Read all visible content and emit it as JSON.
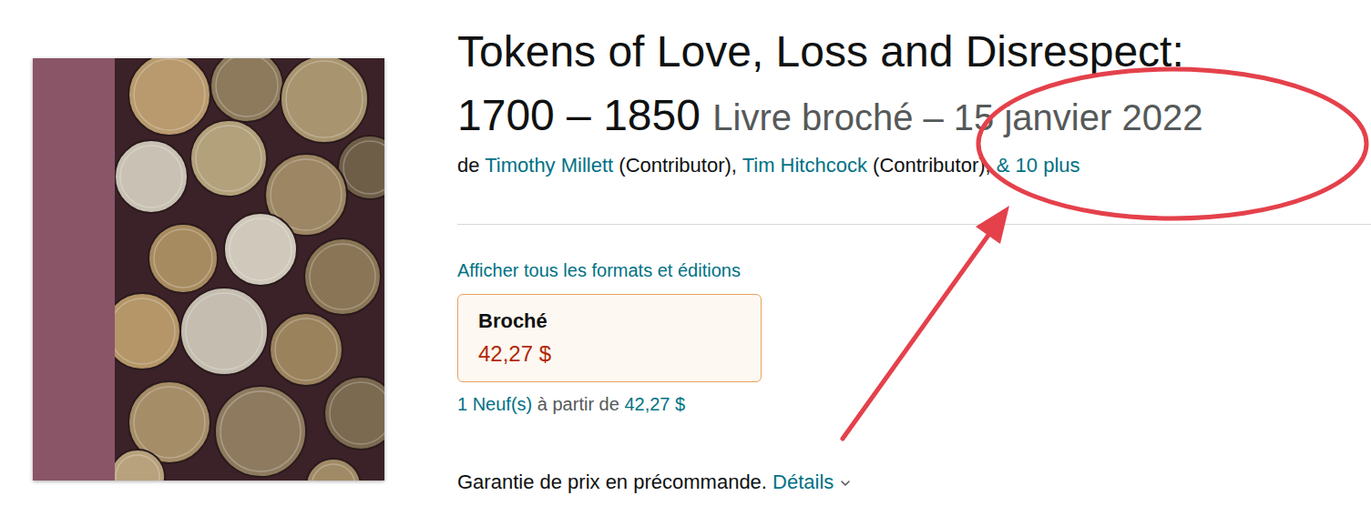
{
  "product": {
    "title_lines": [
      "Tokens of Love, Loss and Disrespect:",
      "1700 – 1850"
    ],
    "binding": "Livre broché – 15 janvier 2022",
    "byline": {
      "prefix": "de",
      "contributors": [
        {
          "name": "Timothy Millett",
          "role": "(Contributor),"
        },
        {
          "name": "Tim Hitchcock",
          "role": "(Contributor),"
        }
      ],
      "more": "& 10 plus"
    },
    "formats_link": "Afficher tous les formats et éditions",
    "formats": [
      {
        "label": "Broché",
        "price": "42,27 $",
        "selected": true
      }
    ],
    "offers": {
      "count": "1 Neuf(s)",
      "text": "à partir de",
      "price": "42,27 $"
    },
    "preorder": {
      "text": "Garantie de prix en précommande.",
      "link": "Détails"
    }
  }
}
